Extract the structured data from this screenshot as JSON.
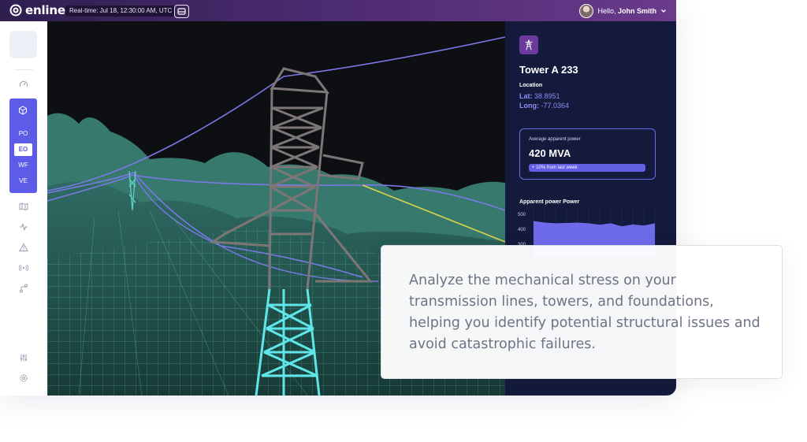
{
  "topbar": {
    "brand": "enline",
    "realtime": "Real-time: Jul 18, 12:30:00 AM, UTC",
    "greeting": "Hello,",
    "user_name": "John Smith"
  },
  "sidebar": {
    "group_items": [
      {
        "label": "PO"
      },
      {
        "label": "EO",
        "active": true
      },
      {
        "label": "WF"
      },
      {
        "label": "VE"
      }
    ],
    "accent": "#5d5ce8"
  },
  "panel": {
    "title": "Tower A 233",
    "location_label": "Location",
    "lat_label": "Lat:",
    "lat_value": "38.8951",
    "long_label": "Long:",
    "long_value": "-77.0364",
    "power_card": {
      "label": "Average apparent power",
      "value": "420 MVA",
      "badge": "+ 10% from last week"
    },
    "chart_title": "Apparent power Power"
  },
  "chart_data": {
    "type": "area",
    "title": "Apparent power Power",
    "yticks": [
      "500",
      "400",
      "300"
    ],
    "ylim": [
      300,
      500
    ],
    "values": [
      455,
      445,
      440,
      442,
      445,
      440,
      430,
      440,
      420,
      432,
      425,
      440
    ],
    "color": "#6d6bea"
  },
  "callout": {
    "text": "Analyze the mechanical stress on your transmission lines, towers, and foundations, helping you identify potential structural issues and avoid catastrophic failures."
  }
}
